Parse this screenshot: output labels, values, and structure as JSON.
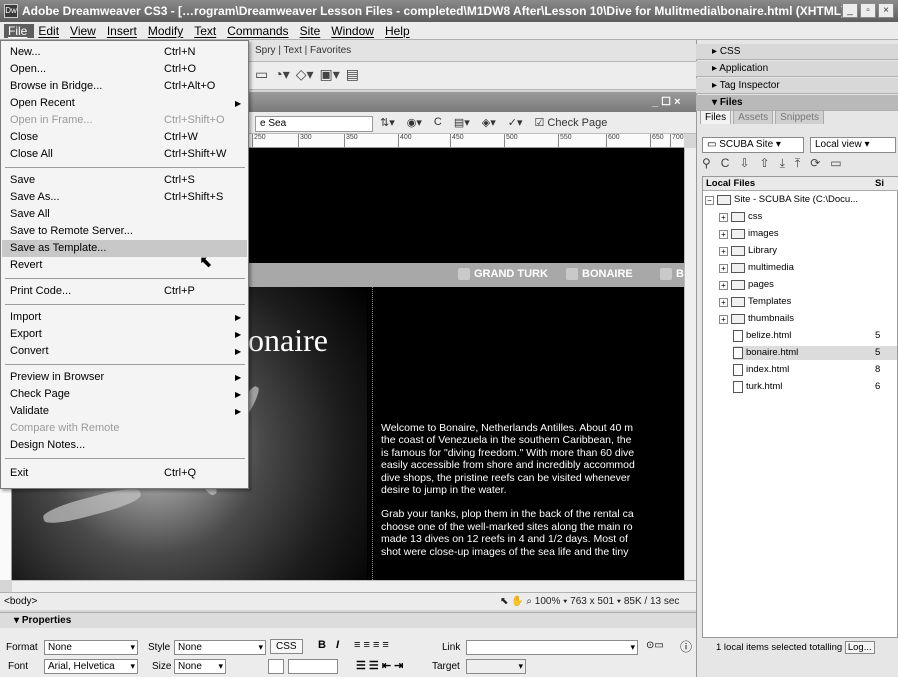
{
  "window": {
    "title": "Adobe Dreamweaver CS3 - […rogram\\Dreamweaver Lesson Files - completed\\M1DW8 After\\Lesson 10\\Dive for Mulitmedia\\bonaire.html (XHTML)*]"
  },
  "menubar": [
    "File",
    "Edit",
    "View",
    "Insert",
    "Modify",
    "Text",
    "Commands",
    "Site",
    "Window",
    "Help"
  ],
  "insert_tabs": "Spry | Text | Favorites",
  "file_menu": {
    "items": [
      {
        "label": "New...",
        "shortcut": "Ctrl+N"
      },
      {
        "label": "Open...",
        "shortcut": "Ctrl+O"
      },
      {
        "label": "Browse in Bridge...",
        "shortcut": "Ctrl+Alt+O"
      },
      {
        "label": "Open Recent",
        "shortcut": ""
      },
      {
        "label": "Open in Frame...",
        "shortcut": "Ctrl+Shift+O"
      },
      {
        "label": "Close",
        "shortcut": "Ctrl+W"
      },
      {
        "label": "Close All",
        "shortcut": "Ctrl+Shift+W"
      },
      {
        "label": "Save",
        "shortcut": "Ctrl+S"
      },
      {
        "label": "Save As...",
        "shortcut": "Ctrl+Shift+S"
      },
      {
        "label": "Save All",
        "shortcut": ""
      },
      {
        "label": "Save to Remote Server...",
        "shortcut": ""
      },
      {
        "label": "Save as Template...",
        "shortcut": ""
      },
      {
        "label": "Revert",
        "shortcut": ""
      },
      {
        "label": "Print Code...",
        "shortcut": "Ctrl+P"
      },
      {
        "label": "Import",
        "shortcut": ""
      },
      {
        "label": "Export",
        "shortcut": ""
      },
      {
        "label": "Convert",
        "shortcut": ""
      },
      {
        "label": "Preview in Browser",
        "shortcut": ""
      },
      {
        "label": "Check Page",
        "shortcut": ""
      },
      {
        "label": "Validate",
        "shortcut": ""
      },
      {
        "label": "Compare with Remote",
        "shortcut": ""
      },
      {
        "label": "Design Notes...",
        "shortcut": ""
      },
      {
        "label": "Exit",
        "shortcut": "Ctrl+Q"
      }
    ]
  },
  "document": {
    "title_field": "e Sea",
    "check_page": "Check Page",
    "ruler_ticks": [
      "250",
      "300",
      "350",
      "400",
      "450",
      "500",
      "550",
      "600",
      "650",
      "700",
      "75"
    ],
    "nav": [
      "GRAND TURK",
      "BONAIRE",
      "B"
    ],
    "heading": "onaire",
    "paragraph1": [
      "Welcome to Bonaire, Netherlands Antilles. About 40 m",
      "the coast of Venezuela in the southern Caribbean, the",
      "is famous for \"diving freedom.\" With more than 60 dive",
      "easily accessible from shore and incredibly accommod",
      "dive shops, the pristine reefs can be visited whenever",
      "desire to jump in the water."
    ],
    "paragraph2": [
      "Grab your tanks, plop them in the back of the rental ca",
      "choose one of the well-marked sites along the main ro",
      "made 13 dives on 12 reefs in 4 and 1/2 days. Most of",
      "shot were close-up images of the sea life and the tiny"
    ]
  },
  "status": {
    "tag": "<body>",
    "zoom": "100%",
    "size": "763 x 501",
    "weight": "85K / 13 sec"
  },
  "properties": {
    "title": "Properties",
    "format_label": "Format",
    "format_value": "None",
    "style_label": "Style",
    "style_value": "None",
    "css_label": "CSS",
    "link_label": "Link",
    "font_label": "Font",
    "font_value": "Arial, Helvetica",
    "size_label": "Size",
    "size_value": "None",
    "target_label": "Target"
  },
  "panels": {
    "css": "CSS",
    "application": "Application",
    "tag_inspector": "Tag Inspector",
    "files": "Files",
    "tabs": [
      "Files",
      "Assets",
      "Snippets"
    ],
    "site": "SCUBA Site",
    "view": "Local view",
    "list_header": "Local Files",
    "size_header": "Si",
    "tree": [
      {
        "label": "Site - SCUBA Site (C:\\Docu...",
        "kind": "site",
        "size": ""
      },
      {
        "label": "css",
        "kind": "folder",
        "size": ""
      },
      {
        "label": "images",
        "kind": "folder",
        "size": ""
      },
      {
        "label": "Library",
        "kind": "folder",
        "size": ""
      },
      {
        "label": "multimedia",
        "kind": "folder",
        "size": ""
      },
      {
        "label": "pages",
        "kind": "folder",
        "size": ""
      },
      {
        "label": "Templates",
        "kind": "folder",
        "size": ""
      },
      {
        "label": "thumbnails",
        "kind": "folder",
        "size": ""
      },
      {
        "label": "belize.html",
        "kind": "file",
        "size": "5"
      },
      {
        "label": "bonaire.html",
        "kind": "file",
        "size": "5"
      },
      {
        "label": "index.html",
        "kind": "file",
        "size": "8"
      },
      {
        "label": "turk.html",
        "kind": "file",
        "size": "6"
      }
    ],
    "status": "1 local items selected totalling",
    "log_button": "Log..."
  },
  "colors": {
    "menu_highlight": "#c8c8c8",
    "canvas_bg": "#000000",
    "nav_bg": "#a8a8a8"
  }
}
